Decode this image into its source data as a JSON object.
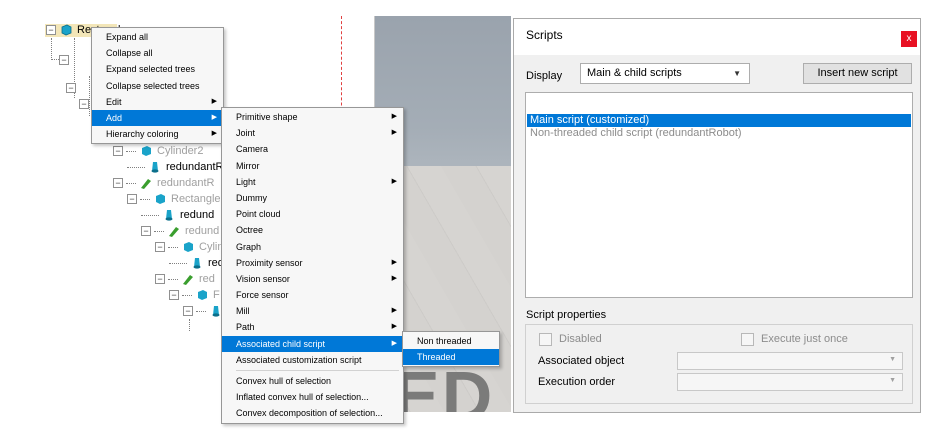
{
  "hierarchy": {
    "root_label": "Rectangle",
    "rows": [
      {
        "name": "Cylinder2",
        "dim": true
      },
      {
        "name": "redundantR",
        "dim": false
      },
      {
        "name": "redundantR",
        "dim": true
      },
      {
        "name": "Rectangle",
        "dim": true
      },
      {
        "name": "redund",
        "dim": false
      },
      {
        "name": "redund",
        "dim": true
      },
      {
        "name": "Cylin",
        "dim": true
      },
      {
        "name": "red",
        "dim": false
      },
      {
        "name": "red",
        "dim": true
      },
      {
        "name": "F",
        "dim": true
      }
    ]
  },
  "viewport": {
    "overlay_letters": "ED"
  },
  "context_menu": {
    "items": [
      {
        "label": "Expand all"
      },
      {
        "label": "Collapse all"
      },
      {
        "label": "Expand selected trees"
      },
      {
        "label": "Collapse selected trees"
      },
      {
        "label": "Edit",
        "submenu": true
      },
      {
        "label": "Add",
        "submenu": true,
        "highlighted": true
      },
      {
        "label": "Hierarchy coloring",
        "submenu": true
      }
    ]
  },
  "add_submenu": {
    "items": [
      {
        "label": "Primitive shape",
        "submenu": true
      },
      {
        "label": "Joint",
        "submenu": true
      },
      {
        "label": "Camera"
      },
      {
        "label": "Mirror"
      },
      {
        "label": "Light",
        "submenu": true
      },
      {
        "label": "Dummy"
      },
      {
        "label": "Point cloud"
      },
      {
        "label": "Octree"
      },
      {
        "label": "Graph"
      },
      {
        "label": "Proximity sensor",
        "submenu": true
      },
      {
        "label": "Vision sensor",
        "submenu": true
      },
      {
        "label": "Force sensor"
      },
      {
        "label": "Mill",
        "submenu": true
      },
      {
        "label": "Path",
        "submenu": true
      },
      {
        "label": "Associated child script",
        "submenu": true,
        "highlighted": true
      },
      {
        "label": "Associated customization script"
      },
      {
        "label": "Convex hull of selection"
      },
      {
        "label": "Inflated convex hull of selection..."
      },
      {
        "label": "Convex decomposition of selection..."
      }
    ]
  },
  "child_script_submenu": {
    "items": [
      {
        "label": "Non threaded"
      },
      {
        "label": "Threaded",
        "highlighted": true
      }
    ]
  },
  "scripts_dialog": {
    "title": "Scripts",
    "close_glyph": "x",
    "display_label": "Display",
    "display_value": "Main & child scripts",
    "insert_button": "Insert new script",
    "scripts": [
      {
        "label": "Main script (customized)",
        "selected": true
      },
      {
        "label": "Non-threaded child script (redundantRobot)",
        "selected": false
      }
    ],
    "properties_title": "Script properties",
    "disabled_label": "Disabled",
    "execute_once_label": "Execute just once",
    "associated_object_label": "Associated object",
    "associated_object_value": "",
    "execution_order_label": "Execution order",
    "execution_order_value": ""
  },
  "colors": {
    "selection_blue": "#0078d7",
    "close_red": "#e81123",
    "shape_icon": "#1aa3c9",
    "script_icon": "#3a9e2e"
  }
}
